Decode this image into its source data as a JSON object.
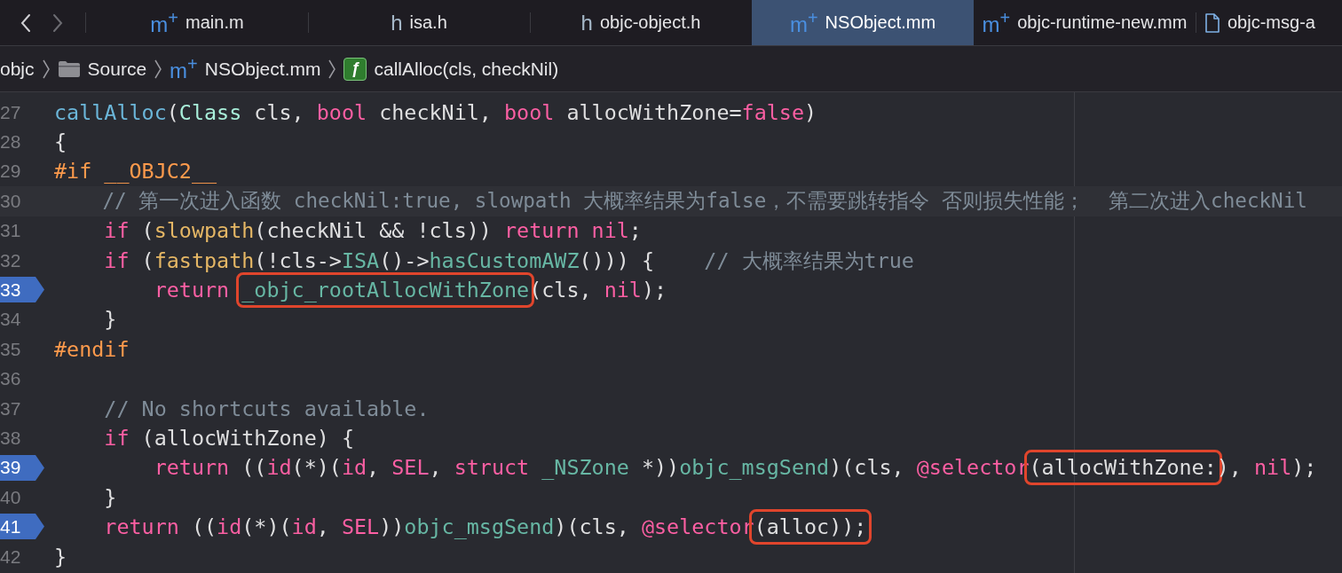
{
  "nav": {
    "back_enabled": true,
    "forward_enabled": false
  },
  "tabs": [
    {
      "glyph": "m$^{+}$",
      "kind": "source",
      "label": "main.m",
      "selected": false
    },
    {
      "glyph": "h",
      "kind": "header",
      "label": "isa.h",
      "selected": false
    },
    {
      "glyph": "h",
      "kind": "header",
      "label": "objc-object.h",
      "selected": false
    },
    {
      "glyph": "m$^{+}$",
      "kind": "source",
      "label": "NSObject.mm",
      "selected": true
    },
    {
      "glyph": "m$^{+}$",
      "kind": "source",
      "label": "objc-runtime-new.mm",
      "selected": false
    },
    {
      "kind": "file",
      "label": "objc-msg-a",
      "selected": false
    }
  ],
  "breadcrumb": [
    {
      "kind": "project",
      "label": "objc"
    },
    {
      "kind": "folder",
      "label": "Source"
    },
    {
      "kind": "source",
      "glyph": "m$^{+}$",
      "label": "NSObject.mm"
    },
    {
      "kind": "function",
      "glyph": "ƒ",
      "label": "callAlloc(cls, checkNil)"
    }
  ],
  "lines": [
    {
      "number": "27",
      "breakpoint": false,
      "highlighted": false,
      "tokens": [
        {
          "text": "callAlloc",
          "kind": "decl"
        },
        {
          "text": "(",
          "kind": "plain"
        },
        {
          "text": "Class",
          "kind": "type"
        },
        {
          "text": " cls, ",
          "kind": "plain"
        },
        {
          "text": "bool",
          "kind": "kw"
        },
        {
          "text": " checkNil, ",
          "kind": "plain"
        },
        {
          "text": "bool",
          "kind": "kw"
        },
        {
          "text": " allocWithZone=",
          "kind": "plain"
        },
        {
          "text": "false",
          "kind": "kw"
        },
        {
          "text": ")",
          "kind": "plain"
        }
      ]
    },
    {
      "number": "28",
      "breakpoint": false,
      "highlighted": false,
      "tokens": [
        {
          "text": "{",
          "kind": "plain"
        }
      ]
    },
    {
      "number": "29",
      "breakpoint": false,
      "highlighted": false,
      "tokens": [
        {
          "text": "#if __OBJC2__",
          "kind": "pre"
        }
      ]
    },
    {
      "number": "30",
      "breakpoint": false,
      "highlighted": true,
      "tokens": [
        {
          "text": "    // 第一次进入函数 checkNil:true, slowpath 大概率结果为false，不需要跳转指令 否则损失性能；  第二次进入checkNil",
          "kind": "comment"
        }
      ]
    },
    {
      "number": "31",
      "breakpoint": false,
      "highlighted": false,
      "tokens": [
        {
          "text": "    if",
          "kind": "kw"
        },
        {
          "text": " (",
          "kind": "plain"
        },
        {
          "text": "slowpath",
          "kind": "macro"
        },
        {
          "text": "(checkNil && !cls)) ",
          "kind": "plain"
        },
        {
          "text": "return ",
          "kind": "kw"
        },
        {
          "text": "nil",
          "kind": "kw"
        },
        {
          "text": ";",
          "kind": "plain"
        }
      ]
    },
    {
      "number": "32",
      "breakpoint": false,
      "highlighted": false,
      "tokens": [
        {
          "text": "    if",
          "kind": "kw"
        },
        {
          "text": " (",
          "kind": "plain"
        },
        {
          "text": "fastpath",
          "kind": "macro"
        },
        {
          "text": "(!cls->",
          "kind": "plain"
        },
        {
          "text": "ISA",
          "kind": "call"
        },
        {
          "text": "()->",
          "kind": "plain"
        },
        {
          "text": "hasCustomAWZ",
          "kind": "call"
        },
        {
          "text": "())) {    ",
          "kind": "plain"
        },
        {
          "text": "// 大概率结果为true",
          "kind": "comment"
        }
      ]
    },
    {
      "number": "33",
      "breakpoint": true,
      "highlighted": false,
      "tokens": [
        {
          "text": "        return ",
          "kind": "kw"
        },
        {
          "text": "_objc_rootAllocWithZone",
          "kind": "call",
          "boxed": true
        },
        {
          "text": "(cls, ",
          "kind": "plain"
        },
        {
          "text": "nil",
          "kind": "kw"
        },
        {
          "text": ");",
          "kind": "plain"
        }
      ]
    },
    {
      "number": "34",
      "breakpoint": false,
      "highlighted": false,
      "tokens": [
        {
          "text": "    }",
          "kind": "plain"
        }
      ]
    },
    {
      "number": "35",
      "breakpoint": false,
      "highlighted": false,
      "tokens": [
        {
          "text": "#endif",
          "kind": "pre"
        }
      ]
    },
    {
      "number": "36",
      "breakpoint": false,
      "highlighted": false
    },
    {
      "number": "37",
      "breakpoint": false,
      "highlighted": false,
      "tokens": [
        {
          "text": "    // No shortcuts available.",
          "kind": "comment"
        }
      ]
    },
    {
      "number": "38",
      "breakpoint": false,
      "highlighted": false,
      "tokens": [
        {
          "text": "    if",
          "kind": "kw"
        },
        {
          "text": " (allocWithZone) {",
          "kind": "plain"
        }
      ]
    },
    {
      "number": "39",
      "breakpoint": true,
      "highlighted": false,
      "tokens": [
        {
          "text": "        return",
          "kind": "kw"
        },
        {
          "text": " ((",
          "kind": "plain"
        },
        {
          "text": "id",
          "kind": "kw"
        },
        {
          "text": "(*)(",
          "kind": "plain"
        },
        {
          "text": "id",
          "kind": "kw"
        },
        {
          "text": ", ",
          "kind": "plain"
        },
        {
          "text": "SEL",
          "kind": "kw"
        },
        {
          "text": ", ",
          "kind": "plain"
        },
        {
          "text": "struct ",
          "kind": "kw"
        },
        {
          "text": "_NSZone",
          "kind": "call"
        },
        {
          "text": " *))",
          "kind": "plain"
        },
        {
          "text": "objc_msgSend",
          "kind": "call"
        },
        {
          "text": ")(cls, ",
          "kind": "plain"
        },
        {
          "text": "@selector",
          "kind": "kw"
        },
        {
          "text": "(allocWithZone:",
          "kind": "plain",
          "boxed": true
        },
        {
          "text": "), ",
          "kind": "plain"
        },
        {
          "text": "nil",
          "kind": "kw"
        },
        {
          "text": ");",
          "kind": "plain"
        }
      ]
    },
    {
      "number": "40",
      "breakpoint": false,
      "highlighted": false,
      "tokens": [
        {
          "text": "    }",
          "kind": "plain"
        }
      ]
    },
    {
      "number": "41",
      "breakpoint": true,
      "highlighted": false,
      "tokens": [
        {
          "text": "    return",
          "kind": "kw"
        },
        {
          "text": " ((",
          "kind": "plain"
        },
        {
          "text": "id",
          "kind": "kw"
        },
        {
          "text": "(*)(",
          "kind": "plain"
        },
        {
          "text": "id",
          "kind": "kw"
        },
        {
          "text": ", ",
          "kind": "plain"
        },
        {
          "text": "SEL",
          "kind": "kw"
        },
        {
          "text": "))",
          "kind": "plain"
        },
        {
          "text": "objc_msgSend",
          "kind": "call"
        },
        {
          "text": ")(cls, ",
          "kind": "plain"
        },
        {
          "text": "@selector",
          "kind": "kw"
        },
        {
          "text": "(alloc));",
          "kind": "plain",
          "boxed": true
        }
      ]
    },
    {
      "number": "42",
      "breakpoint": false,
      "highlighted": false,
      "tokens": [
        {
          "text": "}",
          "kind": "plain"
        }
      ]
    }
  ]
}
